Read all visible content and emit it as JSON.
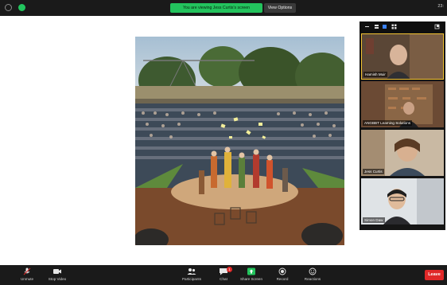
{
  "top_bar": {
    "share_message": "You are viewing Jess Curtis's screen",
    "view_options_label": "View Options",
    "right_text": "23:"
  },
  "shared_screen": {
    "description_icon": "theatre-photo"
  },
  "participants": [
    {
      "name": "Hamish Muir",
      "active": true
    },
    {
      "name": "ANGBBT Learning Solutions"
    },
    {
      "name": "Jess Curtis"
    },
    {
      "name": "Simon Daw"
    }
  ],
  "toolbar": {
    "unmute": "Unmute",
    "stop_video": "Stop Video",
    "participants": "Participants",
    "participants_count": "3",
    "chat": "Chat",
    "chat_badge": "1",
    "share_screen": "Share Screen",
    "record": "Record",
    "reactions": "Reactions",
    "leave": "Leave"
  },
  "colors": {
    "accent_green": "#23c35d",
    "leave_red": "#e02828",
    "active_speaker": "#f2c230"
  }
}
